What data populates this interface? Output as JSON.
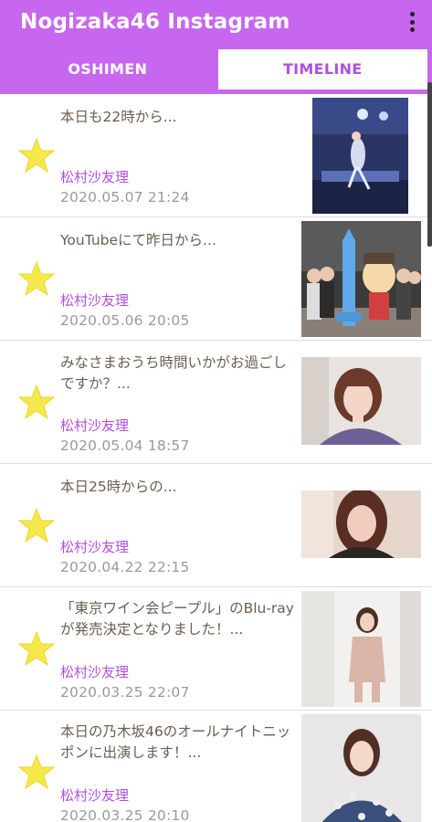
{
  "app": {
    "title": "Nogizaka46 Instagram",
    "menu_icon": "more-vert-icon"
  },
  "tabs": [
    {
      "label": "OSHIMEN",
      "active": true
    },
    {
      "label": "TIMELINE",
      "active": false
    }
  ],
  "posts": [
    {
      "text": "本日も22時から...",
      "author": "松村沙友理",
      "date": "2020.05.07 21:24",
      "favorite_icon": "star-icon"
    },
    {
      "text": "YouTubeにて昨日から...",
      "author": "松村沙友理",
      "date": "2020.05.06 20:05",
      "favorite_icon": "star-icon"
    },
    {
      "text": "みなさまおうち時間いかがお過ごしですか？...",
      "author": "松村沙友理",
      "date": "2020.05.04 18:57",
      "favorite_icon": "star-icon"
    },
    {
      "text": "本日25時からの...",
      "author": "松村沙友理",
      "date": "2020.04.22 22:15",
      "favorite_icon": "star-icon"
    },
    {
      "text": "「東京ワイン会ピープル」のBlu-rayが発売決定となりました！...",
      "author": "松村沙友理",
      "date": "2020.03.25 22:07",
      "favorite_icon": "star-icon"
    },
    {
      "text": "本日の乃木坂46のオールナイトニッポンに出演します！...",
      "author": "松村沙友理",
      "date": "2020.03.25 20:10",
      "favorite_icon": "star-icon"
    }
  ],
  "colors": {
    "accent": "#c767ef",
    "author": "#b34ee0",
    "star": "#f5e84a"
  }
}
